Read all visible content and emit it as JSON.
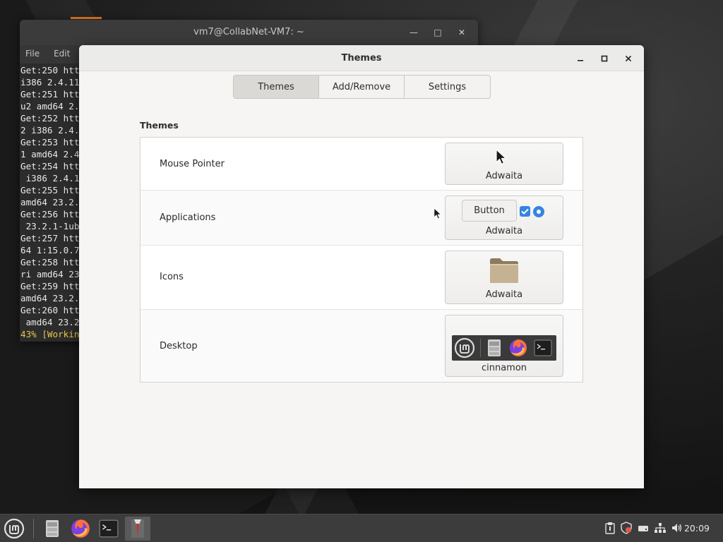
{
  "terminal": {
    "title": "vm7@CollabNet-VM7: ~",
    "menu": [
      "File",
      "Edit"
    ],
    "lines": [
      "Get:250 htt",
      "i386 2.4.11",
      "Get:251 htt",
      "u2 amd64 2.",
      "Get:252 htt",
      "2 i386 2.4.",
      "Get:253 htt",
      "1 amd64 2.4",
      "Get:254 htt",
      " i386 2.4.1",
      "Get:255 htt",
      "amd64 23.2.",
      "Get:256 htt",
      " 23.2.1-1ub",
      "Get:257 htt",
      "64 1:15.0.7",
      "Get:258 htt",
      "ri amd64 23",
      "Get:259 htt",
      "amd64 23.2.",
      "Get:260 htt",
      " amd64 23.2"
    ],
    "progress": "43% [Workin"
  },
  "themes": {
    "title": "Themes",
    "tabs": [
      "Themes",
      "Add/Remove",
      "Settings"
    ],
    "section_title": "Themes",
    "rows": [
      {
        "label": "Mouse Pointer",
        "value": "Adwaita"
      },
      {
        "label": "Applications",
        "value": "Adwaita",
        "preview_button": "Button"
      },
      {
        "label": "Icons",
        "value": "Adwaita"
      },
      {
        "label": "Desktop",
        "value": "cinnamon"
      }
    ]
  },
  "taskbar": {
    "clock": "20:09"
  },
  "colors": {
    "accent": "#3584e4",
    "progress_text": "#e6c64c"
  }
}
